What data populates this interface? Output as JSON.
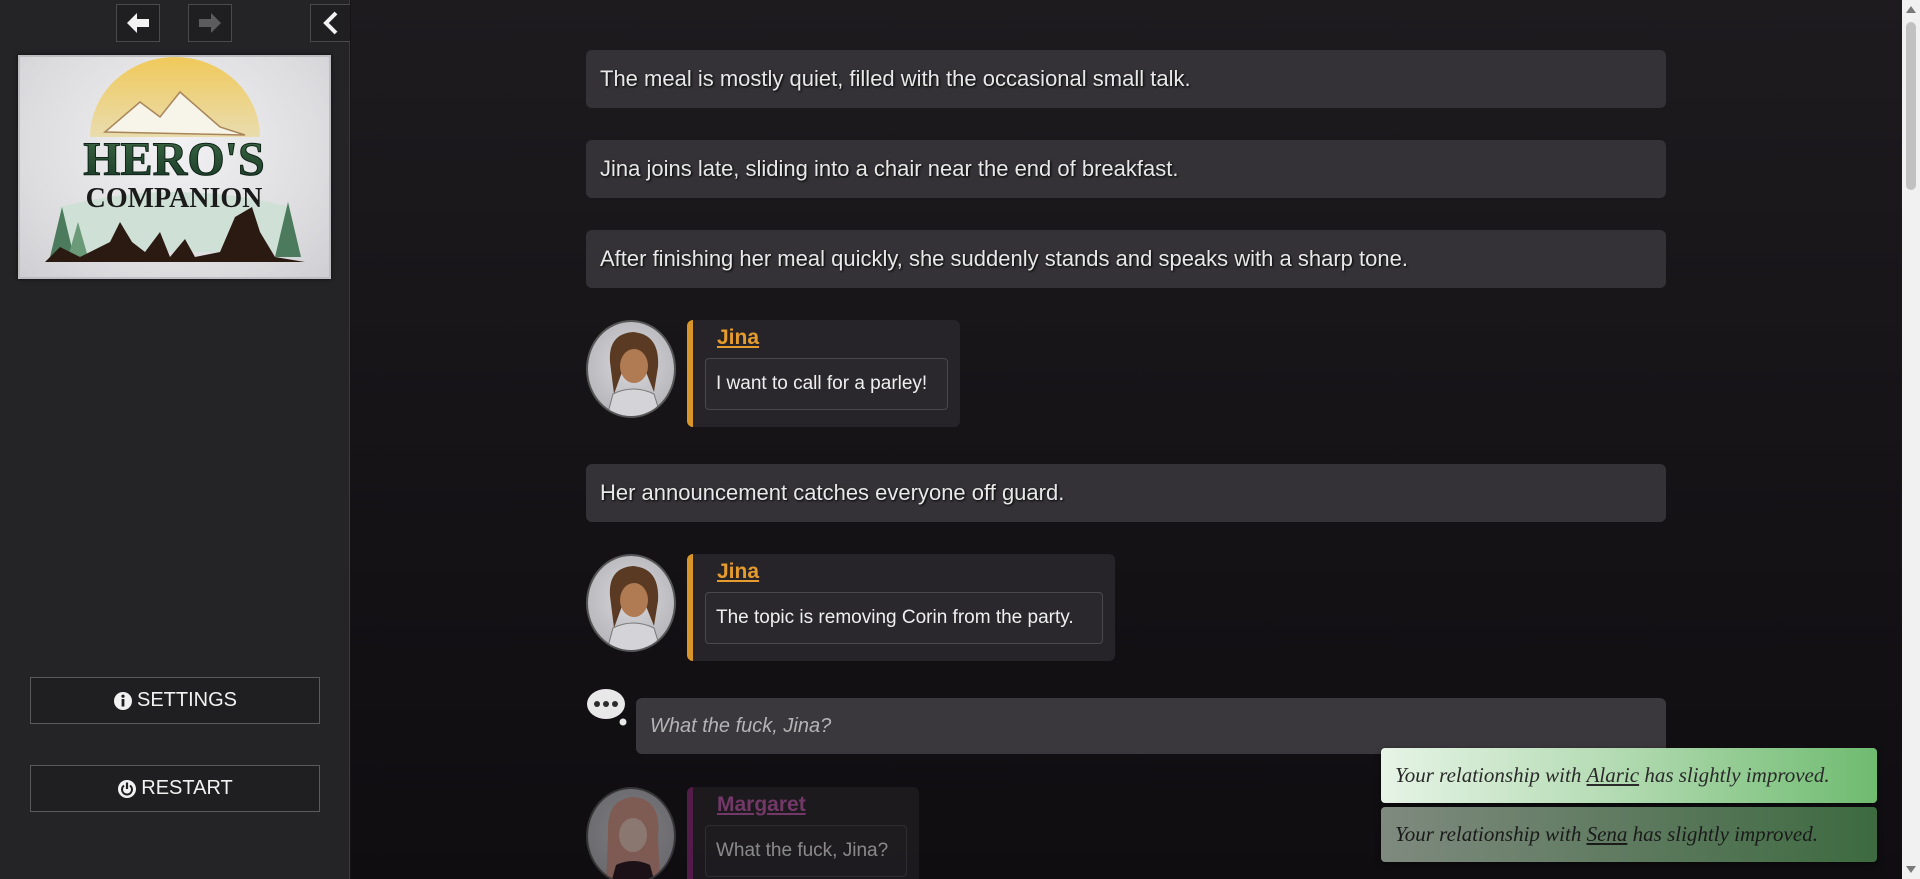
{
  "sidebar": {
    "logo": {
      "line1": "HERO'S",
      "line2": "COMPANION"
    },
    "settings_label": "SETTINGS",
    "restart_label": "RESTART"
  },
  "story": {
    "narration": [
      "The meal is mostly quiet, filled with the occasional small talk.",
      "Jina joins late, sliding into a chair near the end of breakfast.",
      "After finishing her meal quickly, she suddenly stands and speaks with a sharp tone.",
      "Her announcement catches everyone off guard."
    ],
    "dialogue": [
      {
        "speaker": "Jina",
        "text": "I want to call for a parley!"
      },
      {
        "speaker": "Jina",
        "text": "The topic is removing Corin from the party."
      },
      {
        "speaker": "Margaret",
        "text": "What the fuck, Jina?"
      }
    ],
    "thought": "What the fuck, Jina?"
  },
  "toasts": [
    {
      "prefix": "Your relationship with",
      "name": "Alaric",
      "suffix": "has slightly improved."
    },
    {
      "prefix": "Your relationship with",
      "name": "Sena",
      "suffix": "has slightly improved."
    }
  ],
  "colors": {
    "jina_accent": "#d8962a",
    "margaret_accent": "#8a2a7a",
    "toast_green": "#6fbb70"
  }
}
